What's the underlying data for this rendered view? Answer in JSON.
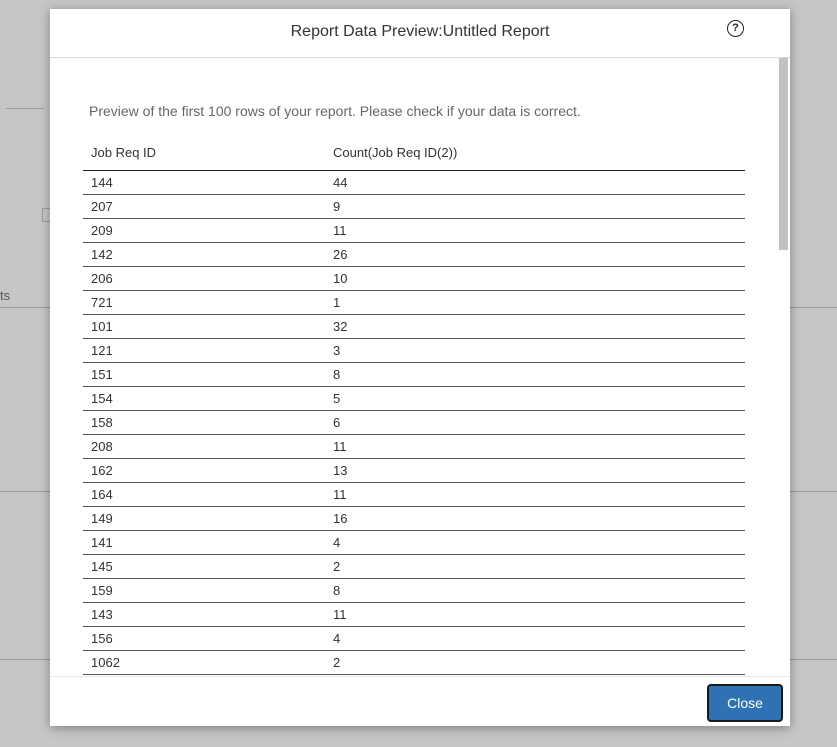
{
  "background": {
    "fragment_text": "ts"
  },
  "dialog": {
    "title": "Report Data Preview:Untitled Report",
    "help_icon": "?",
    "intro": "Preview of the first 100 rows of your report. Please check if your data is correct.",
    "columns": [
      "Job Req ID",
      "Count(Job Req ID(2))"
    ],
    "rows": [
      [
        "144",
        "44"
      ],
      [
        "207",
        "9"
      ],
      [
        "209",
        "11"
      ],
      [
        "142",
        "26"
      ],
      [
        "206",
        "10"
      ],
      [
        "721",
        "1"
      ],
      [
        "101",
        "32"
      ],
      [
        "121",
        "3"
      ],
      [
        "151",
        "8"
      ],
      [
        "154",
        "5"
      ],
      [
        "158",
        "6"
      ],
      [
        "208",
        "11"
      ],
      [
        "162",
        "13"
      ],
      [
        "164",
        "11"
      ],
      [
        "149",
        "16"
      ],
      [
        "141",
        "4"
      ],
      [
        "145",
        "2"
      ],
      [
        "159",
        "8"
      ],
      [
        "143",
        "11"
      ],
      [
        "156",
        "4"
      ],
      [
        "1062",
        "2"
      ]
    ],
    "close_label": "Close"
  },
  "colors": {
    "overlay": "#c6c6c6",
    "primary_button": "#2f72b3"
  }
}
